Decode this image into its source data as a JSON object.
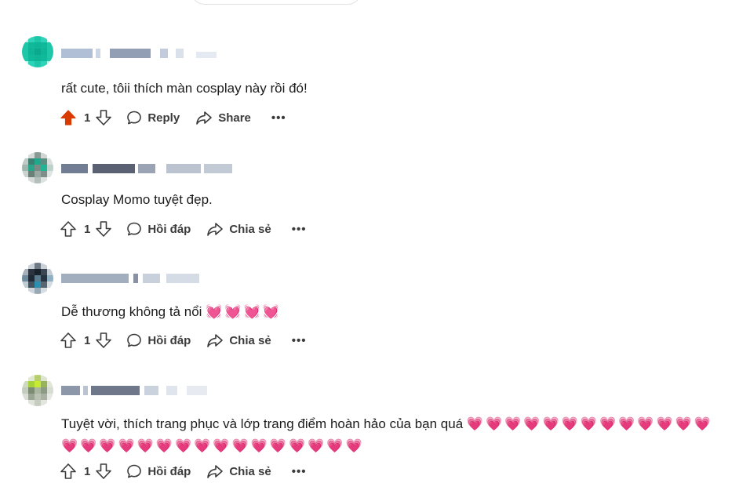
{
  "comments": [
    {
      "text": "rất cute, tôii thích màn cosplay này rồi đó!",
      "hearts": "",
      "hearts_line2": "",
      "upvote_count": "1",
      "upvoted": true,
      "reply_label": "Reply",
      "share_label": "Share",
      "more_label": "•••"
    },
    {
      "text": "Cosplay Momo tuyệt đẹp.",
      "hearts": "",
      "hearts_line2": "",
      "upvote_count": "1",
      "upvoted": false,
      "reply_label": "Hồi đáp",
      "share_label": "Chia sẻ",
      "more_label": "•••"
    },
    {
      "text": "Dễ thương không tả nổi",
      "hearts": "💓💓💓💓",
      "hearts_line2": "",
      "upvote_count": "1",
      "upvoted": false,
      "reply_label": "Hồi đáp",
      "share_label": "Chia sẻ",
      "more_label": "•••"
    },
    {
      "text": "Tuyệt vời, thích trang phục và lớp trang điểm hoàn hảo của bạn quá",
      "hearts": "💗💗💗💗💗💗💗💗💗💗💗💗💗",
      "hearts_line2": "💗💗💗💗💗💗💗💗💗💗💗💗💗💗💗💗",
      "upvote_count": "1",
      "upvoted": false,
      "reply_label": "Hồi đáp",
      "share_label": "Chia sẻ",
      "more_label": "•••"
    }
  ],
  "colors": {
    "upvote_active": "#d93a00",
    "icon_default": "#3b3b3b",
    "heart": "#e8386d"
  },
  "icons": {
    "upvote": "arrow-up-icon",
    "downvote": "arrow-down-icon",
    "reply": "speech-bubble-icon",
    "share": "share-arrow-icon",
    "more": "ellipsis-icon"
  }
}
